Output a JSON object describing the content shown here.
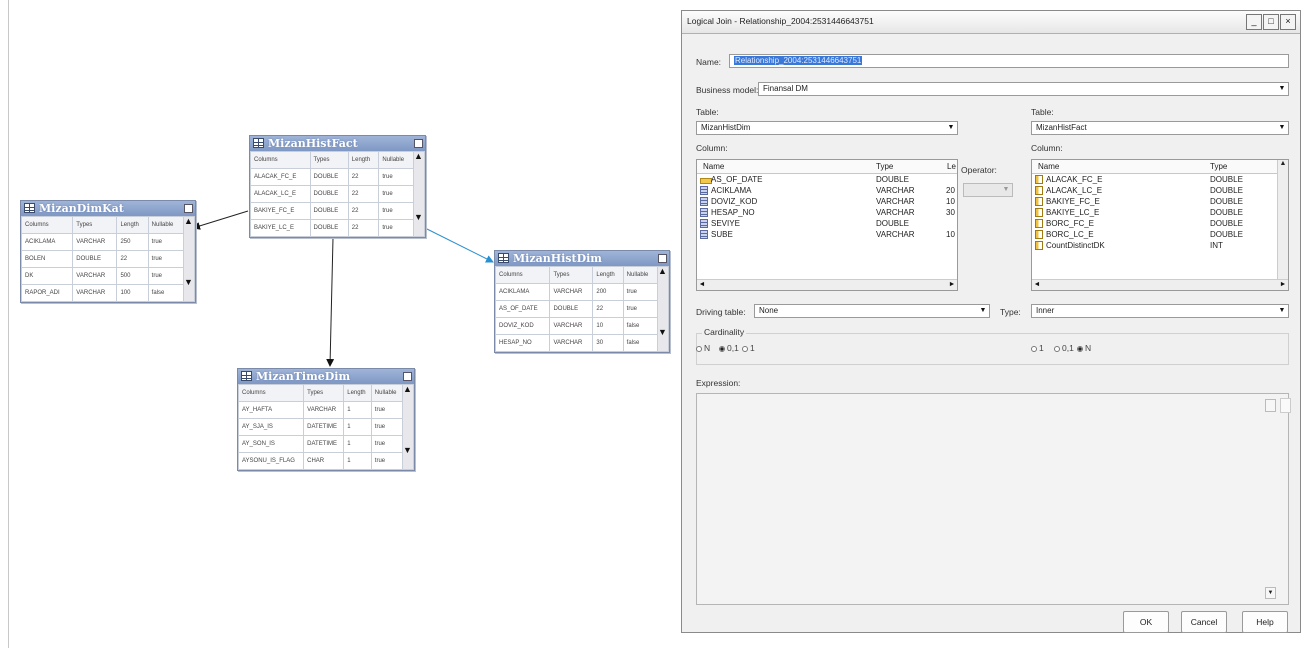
{
  "diagram": {
    "tables": [
      {
        "name": "MizanDimKat",
        "headers": [
          "Columns",
          "Types",
          "Length",
          "Nullable"
        ],
        "rows": [
          [
            "ACIKLAMA",
            "VARCHAR",
            "250",
            "true"
          ],
          [
            "BOLEN",
            "DOUBLE",
            "22",
            "true"
          ],
          [
            "DK",
            "VARCHAR",
            "500",
            "true"
          ],
          [
            "RAPOR_ADI",
            "VARCHAR",
            "100",
            "false"
          ]
        ]
      },
      {
        "name": "MizanHistFact",
        "headers": [
          "Columns",
          "Types",
          "Length",
          "Nullable"
        ],
        "rows": [
          [
            "ALACAK_FC_E",
            "DOUBLE",
            "22",
            "true"
          ],
          [
            "ALACAK_LC_E",
            "DOUBLE",
            "22",
            "true"
          ],
          [
            "BAKIYE_FC_E",
            "DOUBLE",
            "22",
            "true"
          ],
          [
            "BAKIYE_LC_E",
            "DOUBLE",
            "22",
            "true"
          ]
        ]
      },
      {
        "name": "MizanHistDim",
        "headers": [
          "Columns",
          "Types",
          "Length",
          "Nullable"
        ],
        "rows": [
          [
            "ACIKLAMA",
            "VARCHAR",
            "200",
            "true"
          ],
          [
            "AS_OF_DATE",
            "DOUBLE",
            "22",
            "true"
          ],
          [
            "DOVIZ_KOD",
            "VARCHAR",
            "10",
            "false"
          ],
          [
            "HESAP_NO",
            "VARCHAR",
            "30",
            "false"
          ]
        ]
      },
      {
        "name": "MizanTimeDim",
        "headers": [
          "Columns",
          "Types",
          "Length",
          "Nullable"
        ],
        "rows": [
          [
            "AY_HAFTA",
            "VARCHAR",
            "1",
            "true"
          ],
          [
            "AY_SJA_IS",
            "DATETIME",
            "1",
            "true"
          ],
          [
            "AY_SON_IS",
            "DATETIME",
            "1",
            "true"
          ],
          [
            "AYSONU_IS_FLAG",
            "CHAR",
            "1",
            "true"
          ]
        ]
      }
    ]
  },
  "dialog": {
    "title": "Logical Join - Relationship_2004:2531446643751",
    "name_label": "Name:",
    "name_value": "Relationship_2004:2531446643751",
    "business_model_label": "Business model:",
    "business_model_value": "Finansal DM",
    "left": {
      "table_label": "Table:",
      "table_value": "MizanHistDim",
      "column_label": "Column:",
      "headers": [
        "Name",
        "Type",
        "Le"
      ],
      "columns": [
        {
          "name": "AS_OF_DATE",
          "type": "DOUBLE",
          "len": "",
          "icon": "key-icon"
        },
        {
          "name": "ACIKLAMA",
          "type": "VARCHAR",
          "len": "20",
          "icon": "column-icon"
        },
        {
          "name": "DOVIZ_KOD",
          "type": "VARCHAR",
          "len": "10",
          "icon": "column-icon"
        },
        {
          "name": "HESAP_NO",
          "type": "VARCHAR",
          "len": "30",
          "icon": "column-icon"
        },
        {
          "name": "SEVIYE",
          "type": "DOUBLE",
          "len": "",
          "icon": "column-icon"
        },
        {
          "name": "SUBE",
          "type": "VARCHAR",
          "len": "10",
          "icon": "column-icon"
        }
      ]
    },
    "operator_label": "Operator:",
    "right": {
      "table_label": "Table:",
      "table_value": "MizanHistFact",
      "column_label": "Column:",
      "headers": [
        "Name",
        "Type"
      ],
      "columns": [
        {
          "name": "ALACAK_FC_E",
          "type": "DOUBLE"
        },
        {
          "name": "ALACAK_LC_E",
          "type": "DOUBLE"
        },
        {
          "name": "BAKIYE_FC_E",
          "type": "DOUBLE"
        },
        {
          "name": "BAKIYE_LC_E",
          "type": "DOUBLE"
        },
        {
          "name": "BORC_FC_E",
          "type": "DOUBLE"
        },
        {
          "name": "BORC_LC_E",
          "type": "DOUBLE"
        },
        {
          "name": "CountDistinctDK",
          "type": "INT"
        }
      ]
    },
    "driving_table_label": "Driving table:",
    "driving_table_value": "None",
    "type_label": "Type:",
    "type_value": "Inner",
    "cardinality_label": "Cardinality",
    "cardinality_left": [
      {
        "label": "N",
        "selected": false
      },
      {
        "label": "0,1",
        "selected": true
      },
      {
        "label": "1",
        "selected": false
      }
    ],
    "cardinality_right": [
      {
        "label": "1",
        "selected": false
      },
      {
        "label": "0,1",
        "selected": false
      },
      {
        "label": "N",
        "selected": true
      }
    ],
    "expression_label": "Expression:",
    "ok_label": "OK",
    "cancel_label": "Cancel",
    "help_label": "Help"
  }
}
